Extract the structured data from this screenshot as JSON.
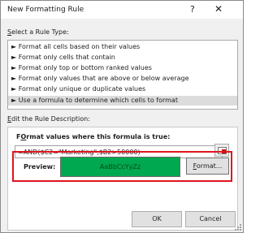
{
  "window": {
    "title": "New Formatting Rule",
    "help_glyph": "?",
    "close_glyph": "✕"
  },
  "rule_type": {
    "label_access": "S",
    "label_rest": "elect a Rule Type:",
    "items": [
      {
        "arrow": "►",
        "text": "Format all cells based on their values"
      },
      {
        "arrow": "►",
        "text": "Format only cells that contain"
      },
      {
        "arrow": "►",
        "text": "Format only top or bottom ranked values"
      },
      {
        "arrow": "►",
        "text": "Format only values that are above or below average"
      },
      {
        "arrow": "►",
        "text": "Format only unique or duplicate values"
      },
      {
        "arrow": "►",
        "text": "Use a formula to determine which cells to format"
      }
    ],
    "selected_index": 5
  },
  "description": {
    "label_access": "E",
    "label_rest": "dit the Rule Description:",
    "formula_heading_access": "O",
    "formula_heading_pre": "F",
    "formula_heading_rest": "rmat values where this formula is true:",
    "formula_value": "=AND($C2=\"Marketing\",$B2>50000)",
    "preview_label": "Preview:",
    "preview_sample": "AaBbCcYyZz",
    "preview_color": "#00a84f",
    "format_button_access": "F",
    "format_button_rest": "ormat...",
    "ok_button": "OK",
    "cancel_button": "Cancel"
  }
}
